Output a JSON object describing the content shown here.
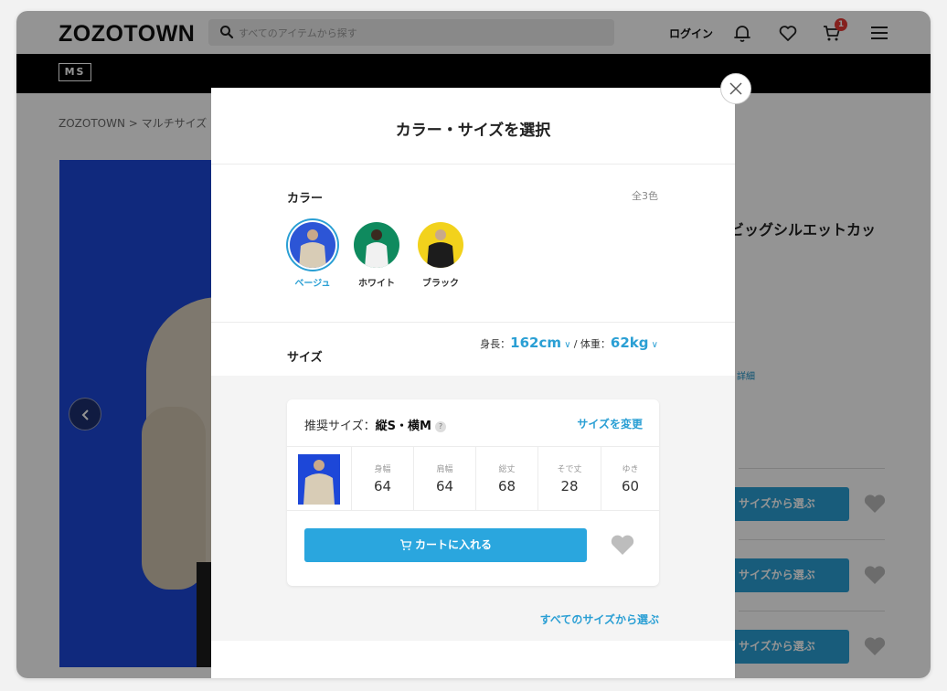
{
  "header": {
    "logo": "ZOZOTOWN",
    "search_placeholder": "すべてのアイテムから探す",
    "login": "ログイン",
    "cart_badge": "1"
  },
  "brand_bar": {
    "logo": "MS"
  },
  "breadcrumb": "ZOZOTOWN > マルチサイズ",
  "product": {
    "title_fragment": "ビッグシルエットカッ",
    "detail_link": "詳細",
    "pick_buttons": [
      "サイズから選ぶ",
      "サイズから選ぶ",
      "サイズから選ぶ"
    ]
  },
  "modal": {
    "title": "カラー・サイズを選択",
    "color_label": "カラー",
    "color_count": "全3色",
    "colors": [
      {
        "name": "ベージュ",
        "bg": "#2c55d6",
        "shirt": "#d8ccb6",
        "selected": true
      },
      {
        "name": "ホワイト",
        "bg": "#0f8a5e",
        "shirt": "#f1f1f1",
        "selected": false
      },
      {
        "name": "ブラック",
        "bg": "#f2d21c",
        "shirt": "#1c1c1c",
        "selected": false
      }
    ],
    "size_label": "サイズ",
    "height_label": "身長：",
    "height_value": "162cm",
    "weight_label": "/ 体重：",
    "weight_value": "62kg",
    "recommend_prefix": "推奨サイズ：",
    "recommend_size": "縦S・横M",
    "help": "?",
    "change_size": "サイズを変更",
    "measurements": [
      {
        "label": "身幅",
        "value": "64"
      },
      {
        "label": "肩幅",
        "value": "64"
      },
      {
        "label": "総丈",
        "value": "68"
      },
      {
        "label": "そで丈",
        "value": "28"
      },
      {
        "label": "ゆき",
        "value": "60"
      }
    ],
    "add_to_cart": "カートに入れる",
    "all_sizes": "すべてのサイズから選ぶ"
  },
  "colors": {
    "accent": "#2a9fd4",
    "cart_button": "#2aa6de",
    "badge": "#e53935"
  }
}
